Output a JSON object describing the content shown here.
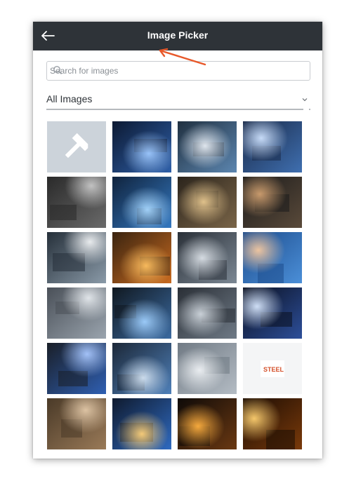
{
  "header": {
    "title": "Image Picker",
    "back_icon": "arrow-left-icon"
  },
  "search": {
    "placeholder": "Search for images",
    "icon": "search-icon"
  },
  "filter": {
    "selected": "All Images",
    "icon": "chevron-down-icon"
  },
  "annotation": {
    "icon": "arrow-pointer-icon",
    "color": "#e8582a"
  },
  "colors": {
    "header_bg": "#2e3338",
    "placeholder_tile": "#ccd3da",
    "brand_logo": "#d4502a"
  },
  "images": [
    {
      "name": "placeholder-hammer-image",
      "kind": "placeholder"
    },
    {
      "name": "welding-sparks-image",
      "kind": "photo"
    },
    {
      "name": "welder-gloves-image",
      "kind": "photo"
    },
    {
      "name": "welder-helmet-image",
      "kind": "photo"
    },
    {
      "name": "welder-workshop-image",
      "kind": "photo"
    },
    {
      "name": "pipes-blue-image",
      "kind": "photo"
    },
    {
      "name": "worker-bent-pipe-image",
      "kind": "photo"
    },
    {
      "name": "welder-night-image",
      "kind": "photo"
    },
    {
      "name": "welder-goggles-image",
      "kind": "photo"
    },
    {
      "name": "grinder-sparks-image",
      "kind": "photo"
    },
    {
      "name": "pipe-machine-image",
      "kind": "photo"
    },
    {
      "name": "worker-hardhat-image",
      "kind": "photo"
    },
    {
      "name": "steel-tubes-image",
      "kind": "photo"
    },
    {
      "name": "welding-machine-image",
      "kind": "photo"
    },
    {
      "name": "pipe-bender-image",
      "kind": "photo"
    },
    {
      "name": "welder-blue-light-image",
      "kind": "photo"
    },
    {
      "name": "welder-blue-suit-image",
      "kind": "photo"
    },
    {
      "name": "welder-coils-image",
      "kind": "photo"
    },
    {
      "name": "steel-profiles-image",
      "kind": "photo"
    },
    {
      "name": "company-logo-image",
      "kind": "logo",
      "logo_text": "STEEL"
    },
    {
      "name": "worker-portrait-image",
      "kind": "photo"
    },
    {
      "name": "welder-kneeling-image",
      "kind": "photo"
    },
    {
      "name": "sparks-burst-image",
      "kind": "photo"
    },
    {
      "name": "sparks-dark-image",
      "kind": "photo"
    }
  ]
}
